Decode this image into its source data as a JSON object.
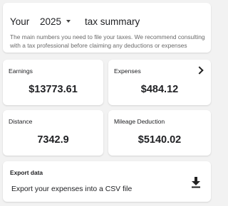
{
  "header": {
    "title_prefix": "Your",
    "year": "2025",
    "title_suffix": "tax summary",
    "description": "The main numbers you need to file your taxes. We recommend consulting with a tax professional before claiming any deductions or expenses"
  },
  "cards": {
    "earnings": {
      "label": "Earnings",
      "value": "$13773.61"
    },
    "expenses": {
      "label": "Expenses",
      "value": "$484.12",
      "icon": "chevron-right-icon"
    },
    "distance": {
      "label": "Distance",
      "value": "7342.9"
    },
    "mileage": {
      "label": "Mileage Deduction",
      "value": "$5140.02"
    }
  },
  "export": {
    "title": "Export data",
    "description": "Export your expenses into a CSV file",
    "icon": "download-icon"
  }
}
